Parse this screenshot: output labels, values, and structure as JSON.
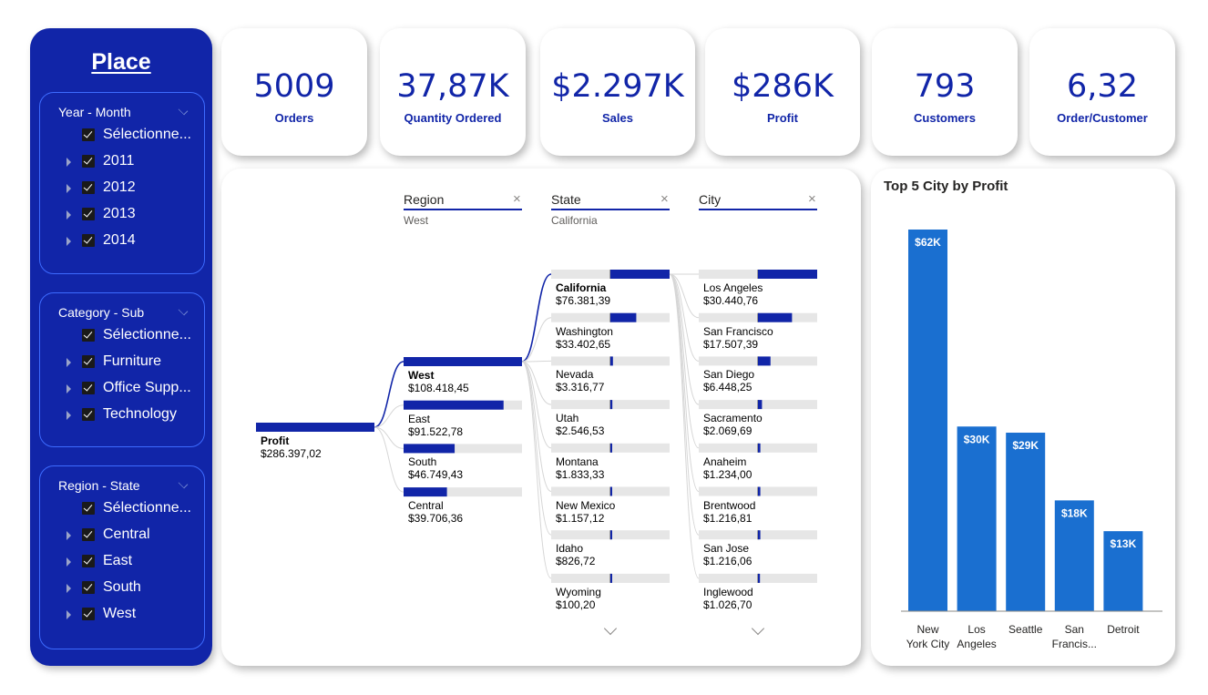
{
  "sidebar": {
    "title": "Place",
    "slicers": [
      {
        "title": "Year - Month",
        "items": [
          {
            "label": "Sélectionne...",
            "expandable": false
          },
          {
            "label": "2011",
            "expandable": true
          },
          {
            "label": "2012",
            "expandable": true
          },
          {
            "label": "2013",
            "expandable": true
          },
          {
            "label": "2014",
            "expandable": true
          }
        ]
      },
      {
        "title": "Category - Sub",
        "items": [
          {
            "label": "Sélectionne...",
            "expandable": false
          },
          {
            "label": "Furniture",
            "expandable": true
          },
          {
            "label": "Office Supp...",
            "expandable": true
          },
          {
            "label": "Technology",
            "expandable": true
          }
        ]
      },
      {
        "title": "Region - State",
        "items": [
          {
            "label": "Sélectionne...",
            "expandable": false
          },
          {
            "label": "Central",
            "expandable": true
          },
          {
            "label": "East",
            "expandable": true
          },
          {
            "label": "South",
            "expandable": true
          },
          {
            "label": "West",
            "expandable": true
          }
        ]
      }
    ]
  },
  "kpis": [
    {
      "value": "5009",
      "label": "Orders"
    },
    {
      "value": "37,87K",
      "label": "Quantity Ordered"
    },
    {
      "value": "$2.297K",
      "label": "Sales"
    },
    {
      "value": "$286K",
      "label": "Profit"
    },
    {
      "value": "793",
      "label": "Customers"
    },
    {
      "value": "6,32",
      "label": "Order/Customer"
    }
  ],
  "tree": {
    "root": {
      "name": "Profit",
      "value": "$286.397,02",
      "amount": 286397.02
    },
    "levels": [
      {
        "header": "Region",
        "selected": "West",
        "nodes": [
          {
            "name": "West",
            "value": "$108.418,45",
            "amount": 108418.45,
            "selected": true
          },
          {
            "name": "East",
            "value": "$91.522,78",
            "amount": 91522.78
          },
          {
            "name": "South",
            "value": "$46.749,43",
            "amount": 46749.43
          },
          {
            "name": "Central",
            "value": "$39.706,36",
            "amount": 39706.36
          }
        ]
      },
      {
        "header": "State",
        "selected": "California",
        "nodes": [
          {
            "name": "California",
            "value": "$76.381,39",
            "amount": 76381.39,
            "selected": true
          },
          {
            "name": "Washington",
            "value": "$33.402,65",
            "amount": 33402.65
          },
          {
            "name": "Nevada",
            "value": "$3.316,77",
            "amount": 3316.77
          },
          {
            "name": "Utah",
            "value": "$2.546,53",
            "amount": 2546.53
          },
          {
            "name": "Montana",
            "value": "$1.833,33",
            "amount": 1833.33
          },
          {
            "name": "New Mexico",
            "value": "$1.157,12",
            "amount": 1157.12
          },
          {
            "name": "Idaho",
            "value": "$826,72",
            "amount": 826.72
          },
          {
            "name": "Wyoming",
            "value": "$100,20",
            "amount": 100.2
          }
        ]
      },
      {
        "header": "City",
        "selected": "",
        "nodes": [
          {
            "name": "Los Angeles",
            "value": "$30.440,76",
            "amount": 30440.76
          },
          {
            "name": "San Francisco",
            "value": "$17.507,39",
            "amount": 17507.39
          },
          {
            "name": "San Diego",
            "value": "$6.448,25",
            "amount": 6448.25
          },
          {
            "name": "Sacramento",
            "value": "$2.069,69",
            "amount": 2069.69
          },
          {
            "name": "Anaheim",
            "value": "$1.234,00",
            "amount": 1234.0
          },
          {
            "name": "Brentwood",
            "value": "$1.216,81",
            "amount": 1216.81
          },
          {
            "name": "San Jose",
            "value": "$1.216,06",
            "amount": 1216.06
          },
          {
            "name": "Inglewood",
            "value": "$1.026,70",
            "amount": 1026.7
          }
        ]
      }
    ]
  },
  "chart_data": {
    "type": "bar",
    "title": "Top 5 City by Profit",
    "categories": [
      "New York City",
      "Los Angeles",
      "Seattle",
      "San Francis...",
      "Detroit"
    ],
    "category_labels": [
      [
        "New",
        "York City"
      ],
      [
        "Los",
        "Angeles"
      ],
      [
        "Seattle"
      ],
      [
        "San",
        "Francis..."
      ],
      [
        "Detroit"
      ]
    ],
    "values": [
      62,
      30,
      29,
      18,
      13
    ],
    "data_labels": [
      "$62K",
      "$30K",
      "$29K",
      "$18K",
      "$13K"
    ],
    "value_unit": "K$",
    "ylim": [
      0,
      62
    ],
    "grid": false,
    "color": "#1a6fd0"
  },
  "colors": {
    "brand": "#1125a8",
    "bar": "#1a6fd0",
    "track": "#e6e6e6"
  }
}
